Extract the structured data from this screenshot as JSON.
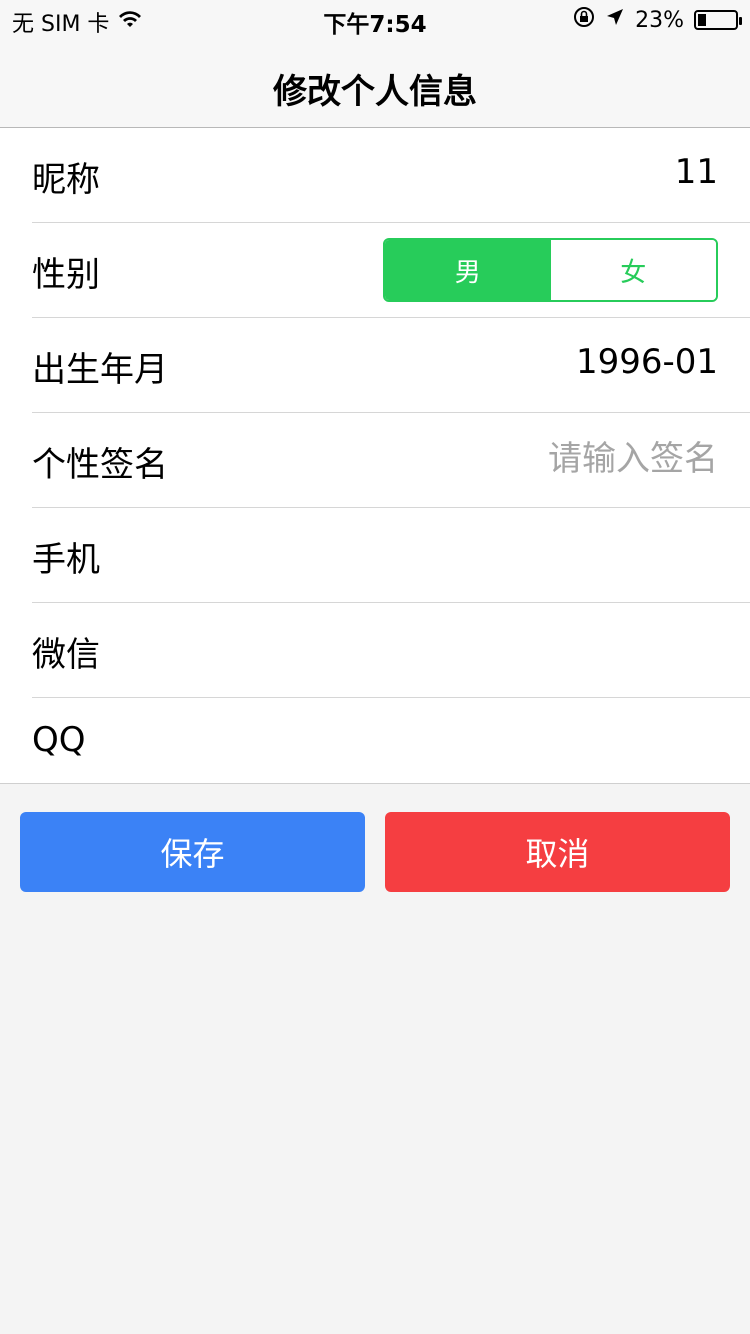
{
  "status_bar": {
    "carrier": "无 SIM 卡",
    "time": "下午7:54",
    "battery_percent_label": "23%",
    "battery_level": 0.23,
    "icons": [
      "wifi-icon",
      "orientation-lock-icon",
      "location-arrow-icon",
      "battery-icon"
    ]
  },
  "nav": {
    "title": "修改个人信息"
  },
  "form": {
    "nickname": {
      "label": "昵称",
      "value": "11"
    },
    "gender": {
      "label": "性别",
      "options": [
        "男",
        "女"
      ],
      "selected": "男"
    },
    "birth": {
      "label": "出生年月",
      "value": "1996-01"
    },
    "signature": {
      "label": "个性签名",
      "value": "",
      "placeholder": "请输入签名"
    },
    "phone": {
      "label": "手机",
      "value": ""
    },
    "wechat": {
      "label": "微信",
      "value": ""
    },
    "qq": {
      "label": "QQ",
      "value": ""
    }
  },
  "actions": {
    "save_label": "保存",
    "cancel_label": "取消"
  },
  "colors": {
    "accent_green": "#27cc5a",
    "save_blue": "#3b82f6",
    "cancel_red": "#f53e41",
    "background": "#f4f4f4"
  }
}
